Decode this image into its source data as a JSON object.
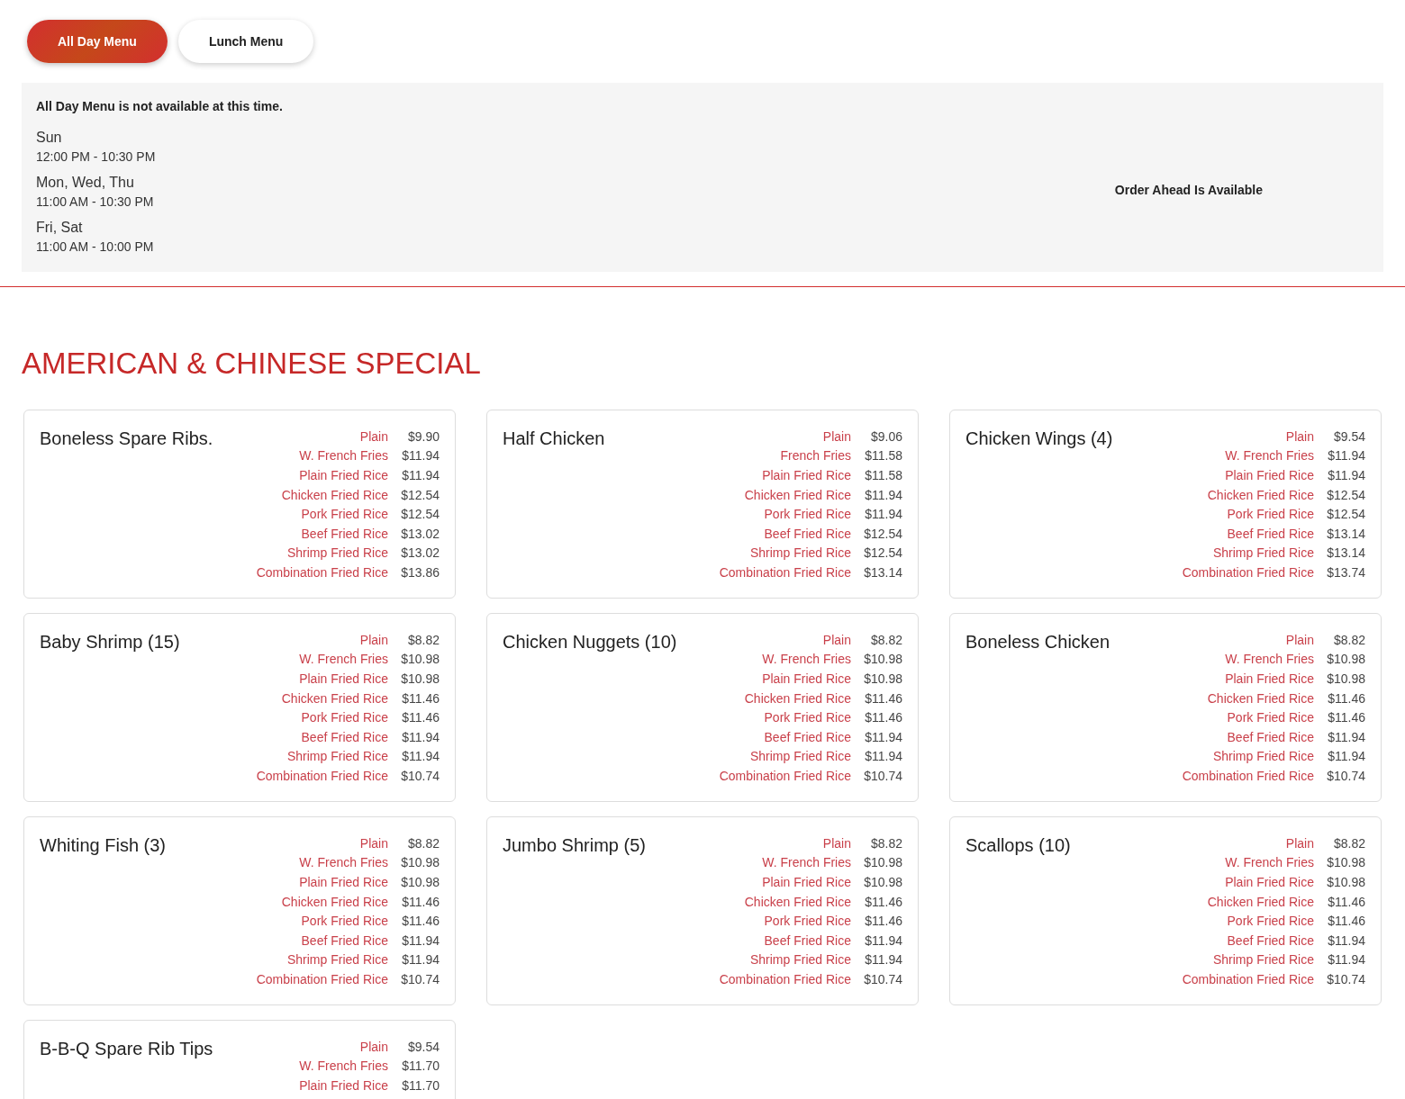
{
  "menu_tabs": [
    {
      "label": "All Day Menu",
      "selected": true
    },
    {
      "label": "Lunch Menu",
      "selected": false
    }
  ],
  "availability": {
    "notice": "All Day Menu is not available at this time.",
    "hours": [
      {
        "days": "Sun",
        "time": "12:00 PM - 10:30 PM"
      },
      {
        "days": "Mon, Wed, Thu",
        "time": "11:00 AM - 10:30 PM"
      },
      {
        "days": "Fri, Sat",
        "time": "11:00 AM - 10:00 PM"
      }
    ],
    "order_ahead": "Order Ahead Is Available"
  },
  "section": {
    "title": "AMERICAN & CHINESE SPECIAL",
    "items": [
      {
        "name": "Boneless Spare Ribs.",
        "options": [
          [
            "Plain",
            "$9.90"
          ],
          [
            "W. French Fries",
            "$11.94"
          ],
          [
            "Plain Fried Rice",
            "$11.94"
          ],
          [
            "Chicken Fried Rice",
            "$12.54"
          ],
          [
            "Pork Fried Rice",
            "$12.54"
          ],
          [
            "Beef Fried Rice",
            "$13.02"
          ],
          [
            "Shrimp Fried Rice",
            "$13.02"
          ],
          [
            "Combination Fried Rice",
            "$13.86"
          ]
        ]
      },
      {
        "name": "Half Chicken",
        "options": [
          [
            "Plain",
            "$9.06"
          ],
          [
            "French Fries",
            "$11.58"
          ],
          [
            "Plain Fried Rice",
            "$11.58"
          ],
          [
            "Chicken Fried Rice",
            "$11.94"
          ],
          [
            "Pork Fried Rice",
            "$11.94"
          ],
          [
            "Beef Fried Rice",
            "$12.54"
          ],
          [
            "Shrimp Fried Rice",
            "$12.54"
          ],
          [
            "Combination Fried Rice",
            "$13.14"
          ]
        ]
      },
      {
        "name": "Chicken Wings (4)",
        "options": [
          [
            "Plain",
            "$9.54"
          ],
          [
            "W. French Fries",
            "$11.94"
          ],
          [
            "Plain Fried Rice",
            "$11.94"
          ],
          [
            "Chicken Fried Rice",
            "$12.54"
          ],
          [
            "Pork Fried Rice",
            "$12.54"
          ],
          [
            "Beef Fried Rice",
            "$13.14"
          ],
          [
            "Shrimp Fried Rice",
            "$13.14"
          ],
          [
            "Combination Fried Rice",
            "$13.74"
          ]
        ]
      },
      {
        "name": "Baby Shrimp (15)",
        "options": [
          [
            "Plain",
            "$8.82"
          ],
          [
            "W. French Fries",
            "$10.98"
          ],
          [
            "Plain Fried Rice",
            "$10.98"
          ],
          [
            "Chicken Fried Rice",
            "$11.46"
          ],
          [
            "Pork Fried Rice",
            "$11.46"
          ],
          [
            "Beef Fried Rice",
            "$11.94"
          ],
          [
            "Shrimp Fried Rice",
            "$11.94"
          ],
          [
            "Combination Fried Rice",
            "$10.74"
          ]
        ]
      },
      {
        "name": "Chicken Nuggets (10)",
        "options": [
          [
            "Plain",
            "$8.82"
          ],
          [
            "W. French Fries",
            "$10.98"
          ],
          [
            "Plain Fried Rice",
            "$10.98"
          ],
          [
            "Chicken Fried Rice",
            "$11.46"
          ],
          [
            "Pork Fried Rice",
            "$11.46"
          ],
          [
            "Beef Fried Rice",
            "$11.94"
          ],
          [
            "Shrimp Fried Rice",
            "$11.94"
          ],
          [
            "Combination Fried Rice",
            "$10.74"
          ]
        ]
      },
      {
        "name": "Boneless Chicken",
        "options": [
          [
            "Plain",
            "$8.82"
          ],
          [
            "W. French Fries",
            "$10.98"
          ],
          [
            "Plain Fried Rice",
            "$10.98"
          ],
          [
            "Chicken Fried Rice",
            "$11.46"
          ],
          [
            "Pork Fried Rice",
            "$11.46"
          ],
          [
            "Beef Fried Rice",
            "$11.94"
          ],
          [
            "Shrimp Fried Rice",
            "$11.94"
          ],
          [
            "Combination Fried Rice",
            "$10.74"
          ]
        ]
      },
      {
        "name": "Whiting Fish (3)",
        "options": [
          [
            "Plain",
            "$8.82"
          ],
          [
            "W. French Fries",
            "$10.98"
          ],
          [
            "Plain Fried Rice",
            "$10.98"
          ],
          [
            "Chicken Fried Rice",
            "$11.46"
          ],
          [
            "Pork Fried Rice",
            "$11.46"
          ],
          [
            "Beef Fried Rice",
            "$11.94"
          ],
          [
            "Shrimp Fried Rice",
            "$11.94"
          ],
          [
            "Combination Fried Rice",
            "$10.74"
          ]
        ]
      },
      {
        "name": "Jumbo Shrimp (5)",
        "options": [
          [
            "Plain",
            "$8.82"
          ],
          [
            "W. French Fries",
            "$10.98"
          ],
          [
            "Plain Fried Rice",
            "$10.98"
          ],
          [
            "Chicken Fried Rice",
            "$11.46"
          ],
          [
            "Pork Fried Rice",
            "$11.46"
          ],
          [
            "Beef Fried Rice",
            "$11.94"
          ],
          [
            "Shrimp Fried Rice",
            "$11.94"
          ],
          [
            "Combination Fried Rice",
            "$10.74"
          ]
        ]
      },
      {
        "name": "Scallops (10)",
        "options": [
          [
            "Plain",
            "$8.82"
          ],
          [
            "W. French Fries",
            "$10.98"
          ],
          [
            "Plain Fried Rice",
            "$10.98"
          ],
          [
            "Chicken Fried Rice",
            "$11.46"
          ],
          [
            "Pork Fried Rice",
            "$11.46"
          ],
          [
            "Beef Fried Rice",
            "$11.94"
          ],
          [
            "Shrimp Fried Rice",
            "$11.94"
          ],
          [
            "Combination Fried Rice",
            "$10.74"
          ]
        ]
      },
      {
        "name": "B-B-Q Spare Rib Tips",
        "options": [
          [
            "Plain",
            "$9.54"
          ],
          [
            "W. French Fries",
            "$11.70"
          ],
          [
            "Plain Fried Rice",
            "$11.70"
          ]
        ]
      }
    ]
  }
}
